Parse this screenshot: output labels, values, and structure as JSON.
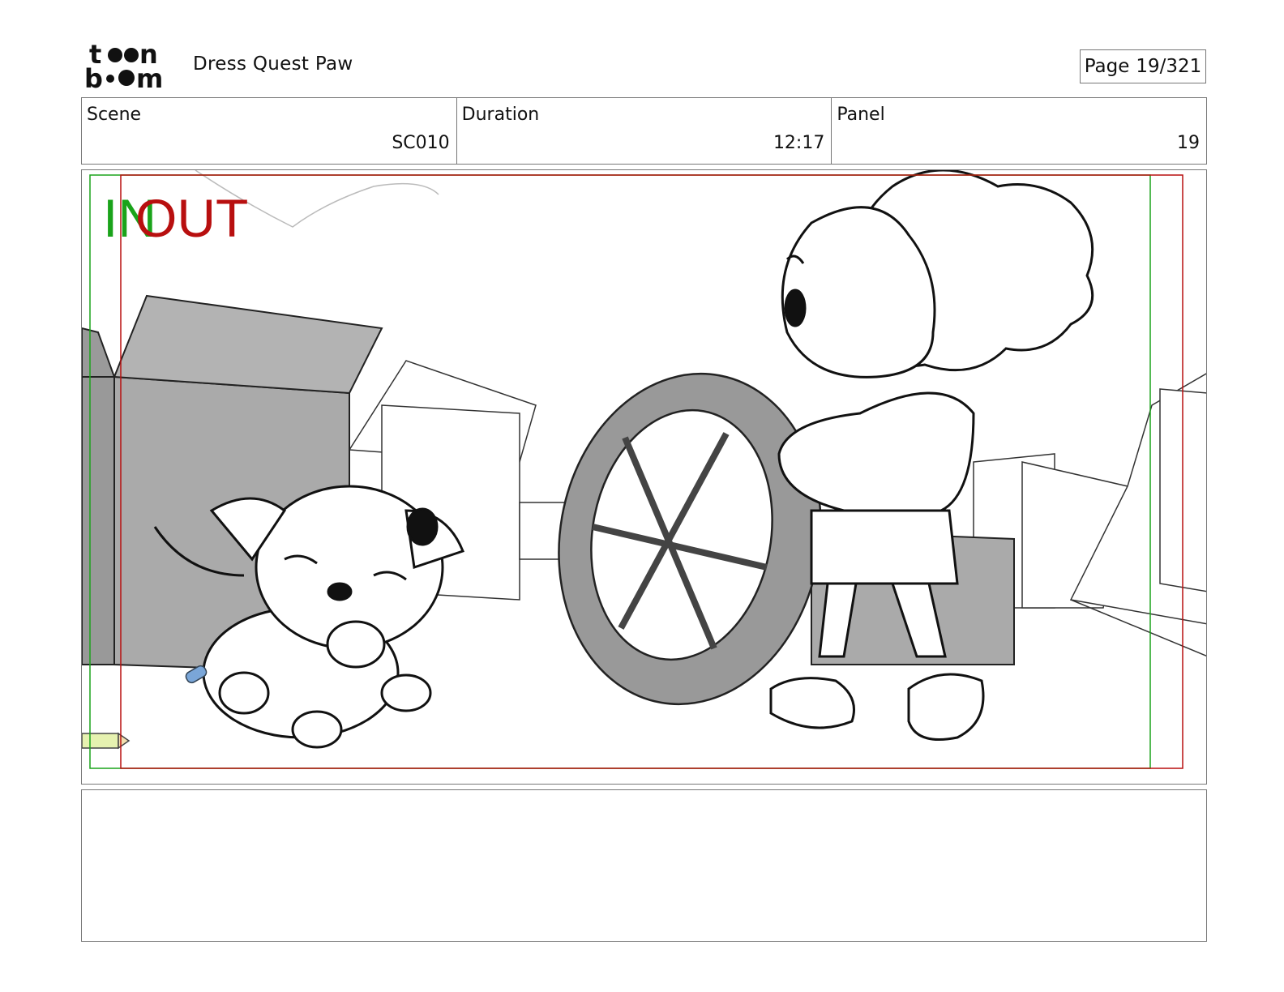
{
  "header": {
    "logo_text": "toon boom",
    "project_title": "Dress Quest Paw",
    "page_label": "Page",
    "page_value": "19/321"
  },
  "info": {
    "scene_label": "Scene",
    "scene_value": "SC010",
    "duration_label": "Duration",
    "duration_value": "12:17",
    "panel_label": "Panel",
    "panel_value": "19"
  },
  "panel": {
    "in_marker": "IN",
    "out_marker": "OUT",
    "colors": {
      "in_frame": "#1aa31a",
      "out_frame": "#b80f0f",
      "box_fill": "#aaaaaa",
      "wheel_fill": "#999999"
    }
  },
  "notes": {
    "text": ""
  }
}
